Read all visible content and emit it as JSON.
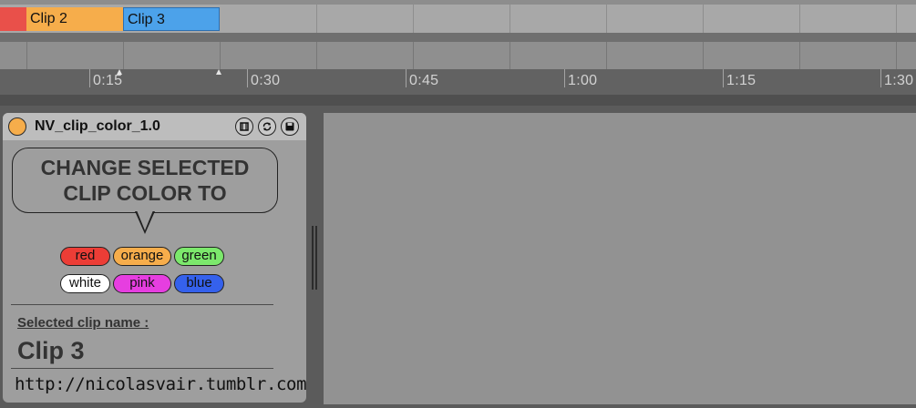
{
  "arrangement": {
    "clips": [
      {
        "label": "Clip 2",
        "color": "#f6ad4b"
      },
      {
        "label": "Clip 3",
        "color": "#4ca2ea"
      }
    ],
    "stub_clip_color": "#e9504a",
    "ruler": {
      "labels": [
        "0:15",
        "0:30",
        "0:45",
        "1:00",
        "1:15",
        "1:30"
      ]
    }
  },
  "device": {
    "title": "NV_clip_color_1.0",
    "power_color": "#f6ad4b",
    "header_icons": [
      "hot-swap-icon",
      "sync-icon",
      "save-preset-icon"
    ],
    "instruction_line1": "CHANGE SELECTED",
    "instruction_line2": "CLIP COLOR TO",
    "color_buttons": [
      {
        "label": "red",
        "color": "#ec3d36"
      },
      {
        "label": "orange",
        "color": "#f6ad4b"
      },
      {
        "label": "green",
        "color": "#7ce86c"
      },
      {
        "label": "white",
        "color": "#ffffff"
      },
      {
        "label": "pink",
        "color": "#e63ee0"
      },
      {
        "label": "blue",
        "color": "#3561ec"
      }
    ],
    "selected_clip_label": "Selected clip name :",
    "selected_clip_name": "Clip 3",
    "url": "http://nicolasvair.tumblr.com"
  }
}
